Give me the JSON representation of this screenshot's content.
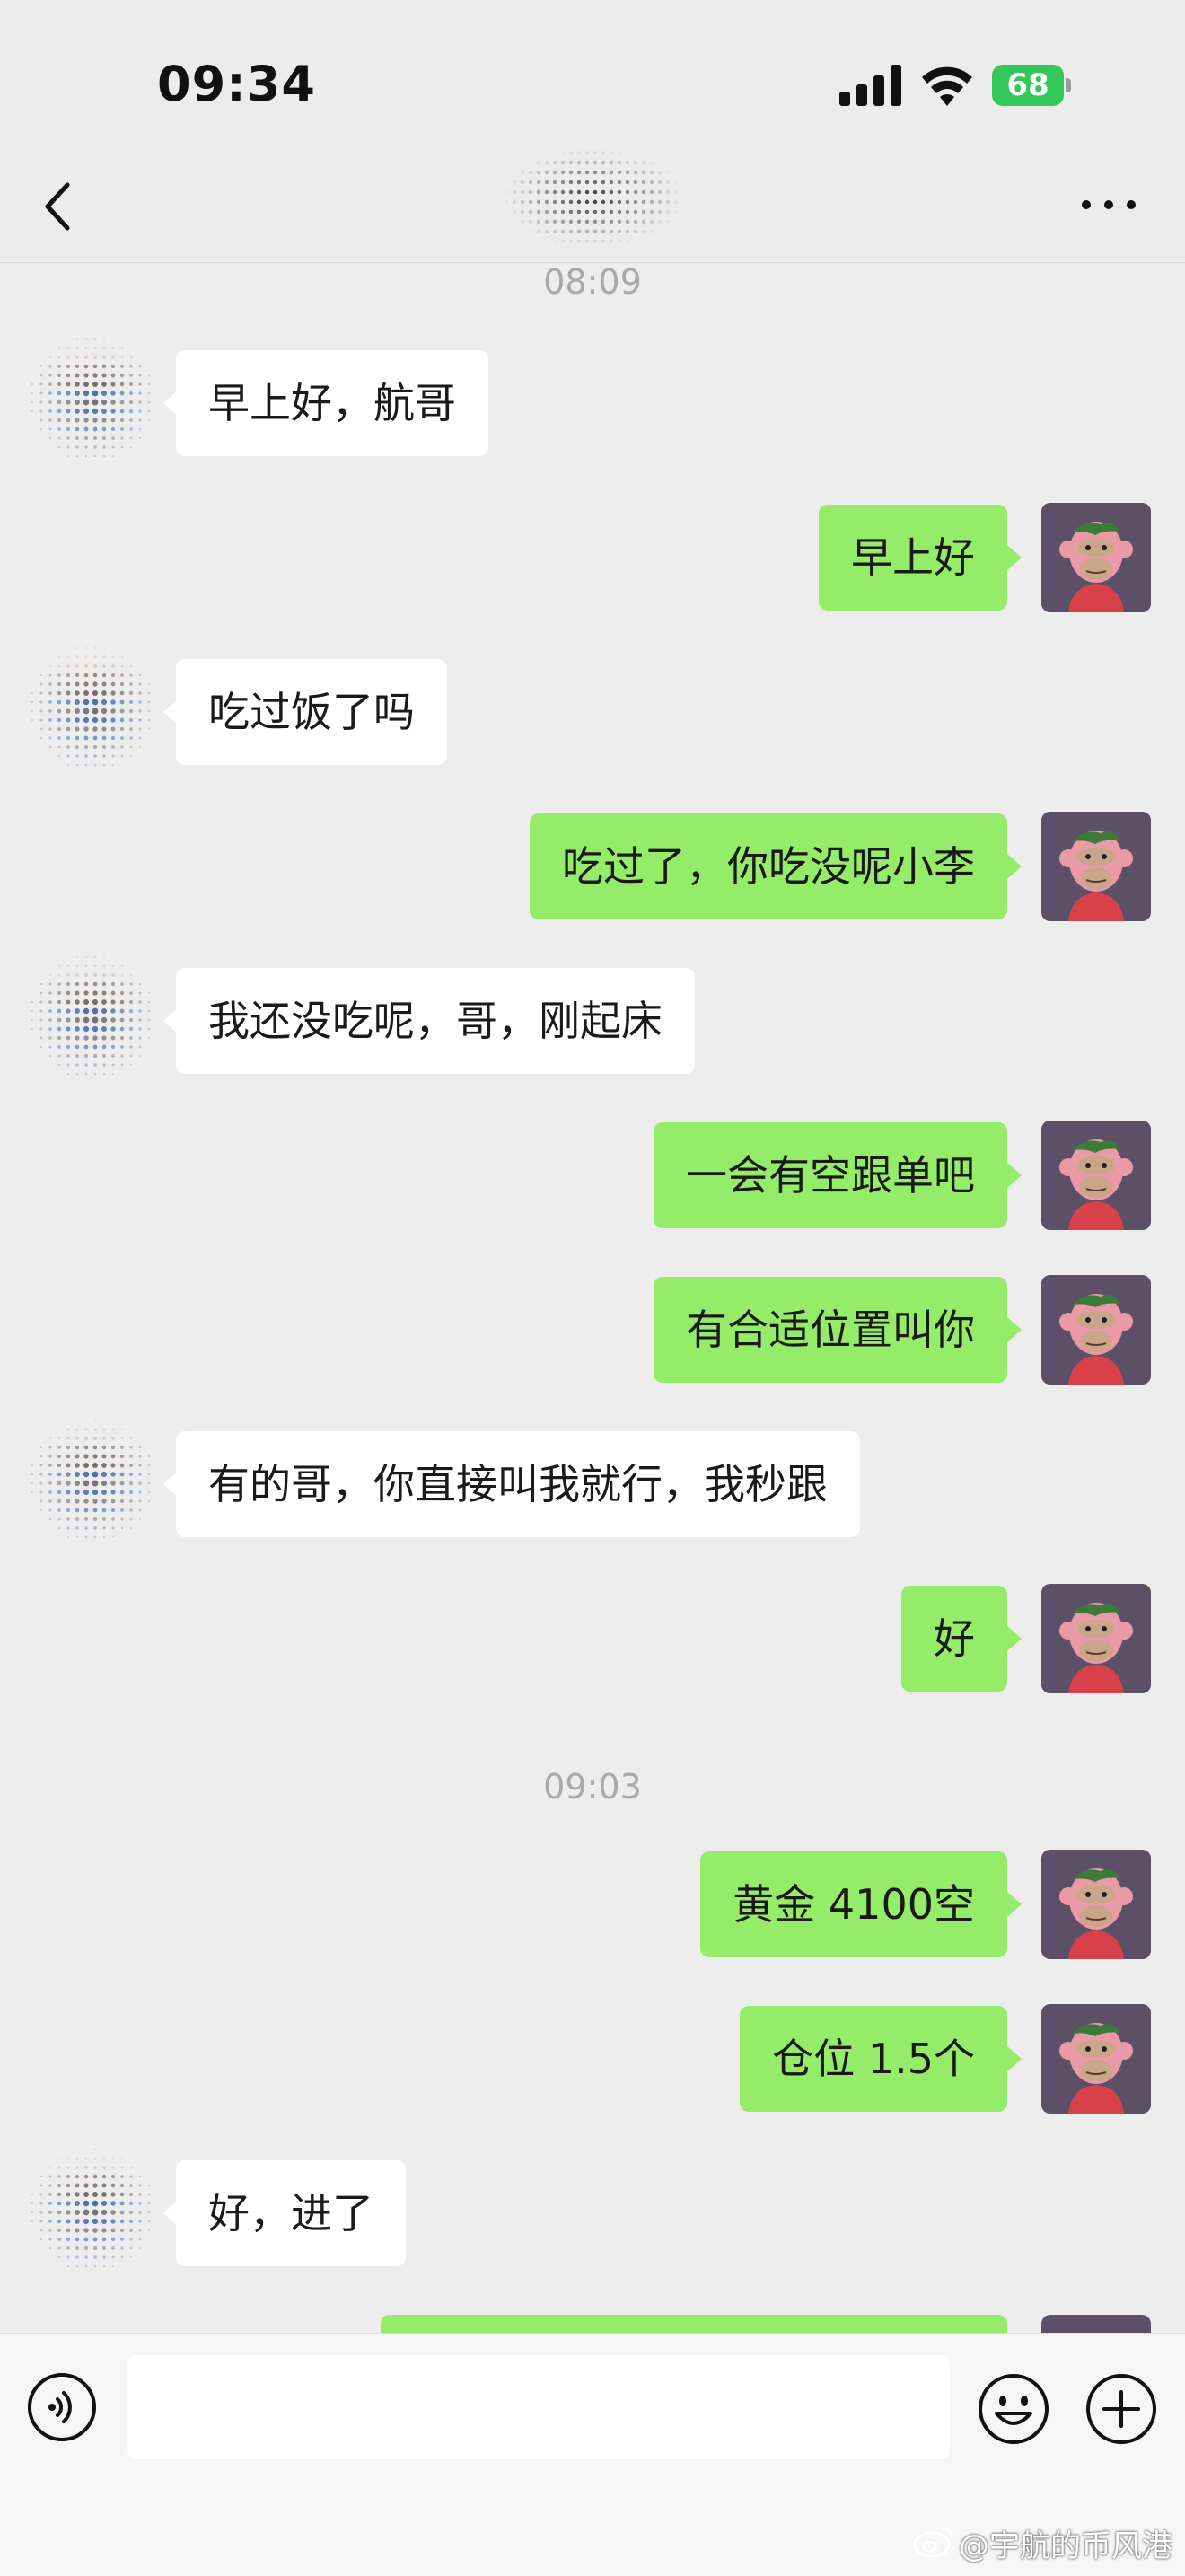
{
  "status_bar": {
    "time": "09:34",
    "battery": "68"
  },
  "header": {
    "back_icon": "chevron-left-icon",
    "more_icon": "more-dots-icon"
  },
  "messages": [
    {
      "type": "time",
      "text": "08:09"
    },
    {
      "type": "in",
      "text": "早上好，航哥"
    },
    {
      "type": "out",
      "text": "早上好"
    },
    {
      "type": "in",
      "text": "吃过饭了吗"
    },
    {
      "type": "out",
      "text": "吃过了，你吃没呢小李"
    },
    {
      "type": "in",
      "text": "我还没吃呢，哥，刚起床"
    },
    {
      "type": "out",
      "text": "一会有空跟单吧"
    },
    {
      "type": "out",
      "text": "有合适位置叫你"
    },
    {
      "type": "in",
      "text": "有的哥，你直接叫我就行，我秒跟"
    },
    {
      "type": "out",
      "text": "好"
    },
    {
      "type": "time",
      "text": "09:03"
    },
    {
      "type": "out",
      "text": "黄金 4100空"
    },
    {
      "type": "out",
      "text": "仓位 1.5个"
    },
    {
      "type": "in",
      "text": "好，进了"
    }
  ],
  "input_bar": {
    "placeholder": "",
    "voice_icon": "voice-icon",
    "emoji_icon": "emoji-icon",
    "plus_icon": "plus-icon"
  },
  "watermark": "@宇航的币风港",
  "colors": {
    "outgoing_bubble": "#95ec69",
    "incoming_bubble": "#ffffff",
    "background": "#ededed"
  }
}
